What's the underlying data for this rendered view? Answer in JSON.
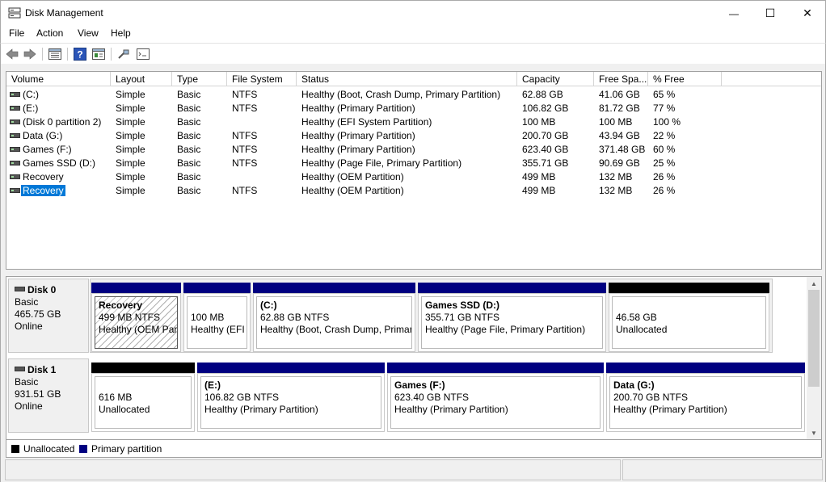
{
  "window": {
    "title": "Disk Management",
    "minimize_glyph": "—",
    "maximize_glyph": "☐",
    "close_glyph": "✕"
  },
  "menu": [
    "File",
    "Action",
    "View",
    "Help"
  ],
  "toolbar": {
    "icons": [
      "back-icon",
      "forward-icon",
      "disk-list-icon",
      "help-icon",
      "console-icon",
      "connect-icon",
      "properties-icon"
    ]
  },
  "volume_list": {
    "columns": [
      "Volume",
      "Layout",
      "Type",
      "File System",
      "Status",
      "Capacity",
      "Free Spa...",
      "% Free"
    ],
    "rows": [
      {
        "volume": " (C:)",
        "layout": "Simple",
        "type": "Basic",
        "fs": "NTFS",
        "status": "Healthy (Boot, Crash Dump, Primary Partition)",
        "capacity": "62.88 GB",
        "free": "41.06 GB",
        "pct": "65 %"
      },
      {
        "volume": " (E:)",
        "layout": "Simple",
        "type": "Basic",
        "fs": "NTFS",
        "status": "Healthy (Primary Partition)",
        "capacity": "106.82 GB",
        "free": "81.72 GB",
        "pct": "77 %"
      },
      {
        "volume": "(Disk 0 partition 2)",
        "layout": "Simple",
        "type": "Basic",
        "fs": "",
        "status": "Healthy (EFI System Partition)",
        "capacity": "100 MB",
        "free": "100 MB",
        "pct": "100 %"
      },
      {
        "volume": "Data (G:)",
        "layout": "Simple",
        "type": "Basic",
        "fs": "NTFS",
        "status": "Healthy (Primary Partition)",
        "capacity": "200.70 GB",
        "free": "43.94 GB",
        "pct": "22 %"
      },
      {
        "volume": "Games (F:)",
        "layout": "Simple",
        "type": "Basic",
        "fs": "NTFS",
        "status": "Healthy (Primary Partition)",
        "capacity": "623.40 GB",
        "free": "371.48 GB",
        "pct": "60 %"
      },
      {
        "volume": "Games SSD (D:)",
        "layout": "Simple",
        "type": "Basic",
        "fs": "NTFS",
        "status": "Healthy (Page File, Primary Partition)",
        "capacity": "355.71 GB",
        "free": "90.69 GB",
        "pct": "25 %"
      },
      {
        "volume": "Recovery",
        "layout": "Simple",
        "type": "Basic",
        "fs": "",
        "status": "Healthy (OEM Partition)",
        "capacity": "499 MB",
        "free": "132 MB",
        "pct": "26 %"
      },
      {
        "volume": "Recovery",
        "layout": "Simple",
        "type": "Basic",
        "fs": "NTFS",
        "status": "Healthy (OEM Partition)",
        "capacity": "499 MB",
        "free": "132 MB",
        "pct": "26 %"
      }
    ]
  },
  "disks": [
    {
      "name": "Disk 0",
      "kind": "Basic",
      "size": "465.75 GB",
      "state": "Online",
      "partitions": [
        {
          "label": "Recovery",
          "line2": "499 MB NTFS",
          "line3": "Healthy (OEM Partition)",
          "kind": "primary"
        },
        {
          "label": "",
          "line2": "100 MB",
          "line3": "Healthy (EFI System Partition)",
          "kind": "primary"
        },
        {
          "label": " (C:)",
          "line2": "62.88 GB NTFS",
          "line3": "Healthy (Boot, Crash Dump, Primary Partition)",
          "kind": "primary"
        },
        {
          "label": "Games SSD  (D:)",
          "line2": "355.71 GB NTFS",
          "line3": "Healthy (Page File, Primary Partition)",
          "kind": "primary"
        },
        {
          "label": "",
          "line2": "46.58 GB",
          "line3": "Unallocated",
          "kind": "unallocated"
        }
      ]
    },
    {
      "name": "Disk 1",
      "kind": "Basic",
      "size": "931.51 GB",
      "state": "Online",
      "partitions": [
        {
          "label": "",
          "line2": "616 MB",
          "line3": "Unallocated",
          "kind": "unallocated"
        },
        {
          "label": " (E:)",
          "line2": "106.82 GB NTFS",
          "line3": "Healthy (Primary Partition)",
          "kind": "primary"
        },
        {
          "label": "Games  (F:)",
          "line2": "623.40 GB NTFS",
          "line3": "Healthy (Primary Partition)",
          "kind": "primary"
        },
        {
          "label": "Data  (G:)",
          "line2": "200.70 GB NTFS",
          "line3": "Healthy (Primary Partition)",
          "kind": "primary"
        }
      ]
    }
  ],
  "legend": [
    {
      "label": "Unallocated",
      "color": "#000000"
    },
    {
      "label": "Primary partition",
      "color": "#000080"
    }
  ],
  "colors": {
    "primary_bar": "#000080",
    "unallocated_bar": "#000000",
    "selection": "#0078d7"
  },
  "scroll": {
    "up_glyph": "▲",
    "down_glyph": "▼"
  }
}
